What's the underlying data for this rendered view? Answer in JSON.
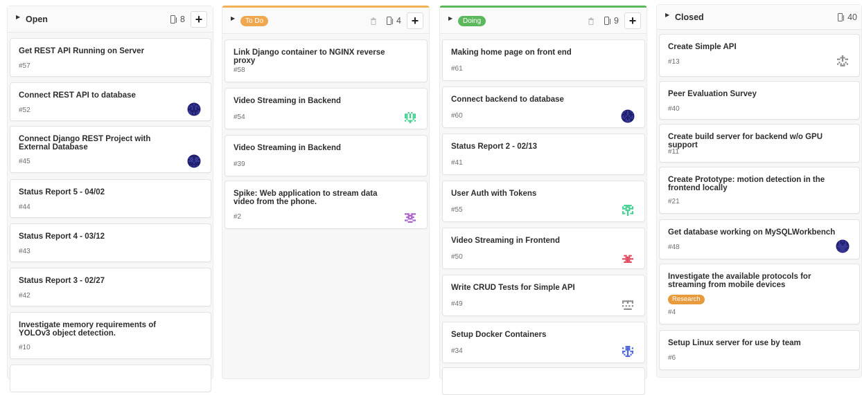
{
  "columns": [
    {
      "name": "Open",
      "count": "8",
      "cards": [
        {
          "title": "Get REST API Running on Server",
          "number": "#57"
        },
        {
          "title": "Connect REST API to database",
          "number": "#52",
          "avatar": "navy"
        },
        {
          "title": "Connect Django REST Project with External Database",
          "number": "#45",
          "avatar": "navy"
        },
        {
          "title": "Status Report 5 - 04/02",
          "number": "#44"
        },
        {
          "title": "Status Report 4 - 03/12",
          "number": "#43"
        },
        {
          "title": "Status Report 3 - 02/27",
          "number": "#42"
        },
        {
          "title": "Investigate memory requirements of YOLOv3 object detection.",
          "number": "#10"
        }
      ]
    },
    {
      "name": "To Do",
      "count": "4",
      "label_color": "#f0a850",
      "cards": [
        {
          "title": "Link Django container to NGINX reverse proxy",
          "number": "#58"
        },
        {
          "title": "Video Streaming in Backend",
          "number": "#54",
          "avatar": "green"
        },
        {
          "title": "Video Streaming in Backend",
          "number": "#39"
        },
        {
          "title": "Spike: Web application to stream data video from the phone.",
          "number": "#2",
          "avatar": "purple"
        }
      ]
    },
    {
      "name": "Doing",
      "count": "9",
      "label_color": "#5cb85c",
      "cards": [
        {
          "title": "Making home page on front end",
          "number": "#61"
        },
        {
          "title": "Connect backend to database",
          "number": "#60",
          "avatar": "navy"
        },
        {
          "title": "Status Report 2 - 02/13",
          "number": "#41"
        },
        {
          "title": "User Auth with Tokens",
          "number": "#55",
          "avatar": "green"
        },
        {
          "title": "Video Streaming in Frontend",
          "number": "#50",
          "avatar": "red"
        },
        {
          "title": "Write CRUD Tests for Simple API",
          "number": "#49",
          "avatar": "gray"
        },
        {
          "title": "Setup Docker Containers",
          "number": "#34",
          "avatar": "blue"
        }
      ]
    },
    {
      "name": "Closed",
      "count": "40",
      "cards": [
        {
          "title": "Create Simple API",
          "number": "#13",
          "avatar": "gray"
        },
        {
          "title": "Peer Evaluation Survey",
          "number": "#40"
        },
        {
          "title": "Create build server for backend w/o GPU support",
          "number": "#11"
        },
        {
          "title": "Create Prototype: motion detection in the frontend locally",
          "number": "#21"
        },
        {
          "title": "Get database working on MySQLWorkbench",
          "number": "#48",
          "avatar": "navy"
        },
        {
          "title": "Investigate the available protocols for streaming from mobile devices",
          "number": "#4",
          "label": "Research"
        },
        {
          "title": "Setup Linux server for use by team",
          "number": "#6"
        }
      ]
    }
  ],
  "colors": {
    "navy": "#1f1f6e",
    "green": "#3fcf8e",
    "purple": "#a855c8",
    "red": "#e0455c",
    "gray": "#8a8a8a",
    "blue": "#4a62d8",
    "research_label": "#e89b3c"
  }
}
